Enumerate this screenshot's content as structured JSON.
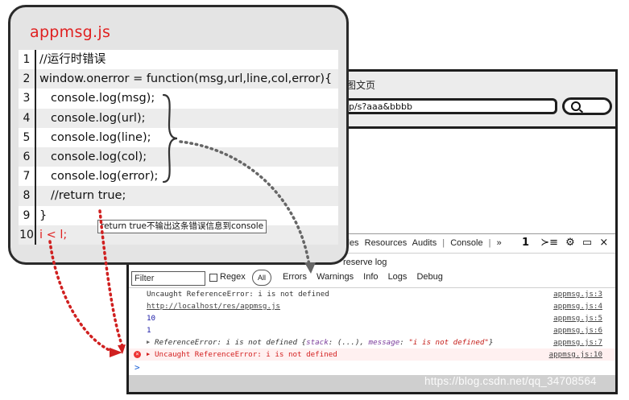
{
  "code_card": {
    "title": "appmsg.js",
    "lines": [
      {
        "num": "1",
        "text": "//运行时错误"
      },
      {
        "num": "2",
        "text": "window.onerror = function(msg,url,line,col,error){"
      },
      {
        "num": "3",
        "text": "console.log(msg);"
      },
      {
        "num": "4",
        "text": "console.log(url);"
      },
      {
        "num": "5",
        "text": "console.log(line);"
      },
      {
        "num": "6",
        "text": "console.log(col);"
      },
      {
        "num": "7",
        "text": "console.log(error);"
      },
      {
        "num": "8",
        "text": "//return true;"
      },
      {
        "num": "9",
        "text": "}"
      },
      {
        "num": "10",
        "text": "i < l;"
      }
    ],
    "tooltip": "return true不输出这条错误信息到console"
  },
  "browser": {
    "tab_title": "图文页",
    "address": "np/s?aaa&bbbb"
  },
  "devtools": {
    "tabs": [
      "files",
      "Resources",
      "Audits",
      "Console"
    ],
    "tabs_more": "»",
    "tab_separator": "|",
    "icons": [
      "error-count-icon",
      "console-drawer-icon",
      "settings-gear-icon",
      "dock-icon",
      "close-icon"
    ],
    "error_count": "1",
    "preserve_log": "reserve log",
    "filter_placeholder": "Filter",
    "regex_label": "Regex",
    "all_label": "All",
    "levels": [
      "Errors",
      "Warnings",
      "Info",
      "Logs",
      "Debug"
    ],
    "logs": [
      {
        "msg": "Uncaught ReferenceError: i is not defined",
        "src": "appmsg.js:3"
      },
      {
        "msg": "http://localhost/res/appmsg.js",
        "src": "appmsg.js:4"
      },
      {
        "msg": "10",
        "src": "appmsg.js:5"
      },
      {
        "msg": "1",
        "src": "appmsg.js:6"
      },
      {
        "msg_prefix": "ReferenceError: i is not defined {",
        "stack_key": "stack",
        "stack_val": ": (...), ",
        "message_key": "message",
        "message_sep": ": ",
        "message_val": "\"i is not defined\"",
        "msg_suffix": "}",
        "src": "appmsg.js:7"
      },
      {
        "msg": "Uncaught ReferenceError: i is not defined",
        "src": "appmsg.js:10"
      }
    ],
    "prompt": ">"
  },
  "watermark": "https://blog.csdn.net/qq_34708564",
  "colors": {
    "accent_red": "#e02020",
    "card_bg": "#e4e4e4",
    "log_link": "#444444"
  }
}
